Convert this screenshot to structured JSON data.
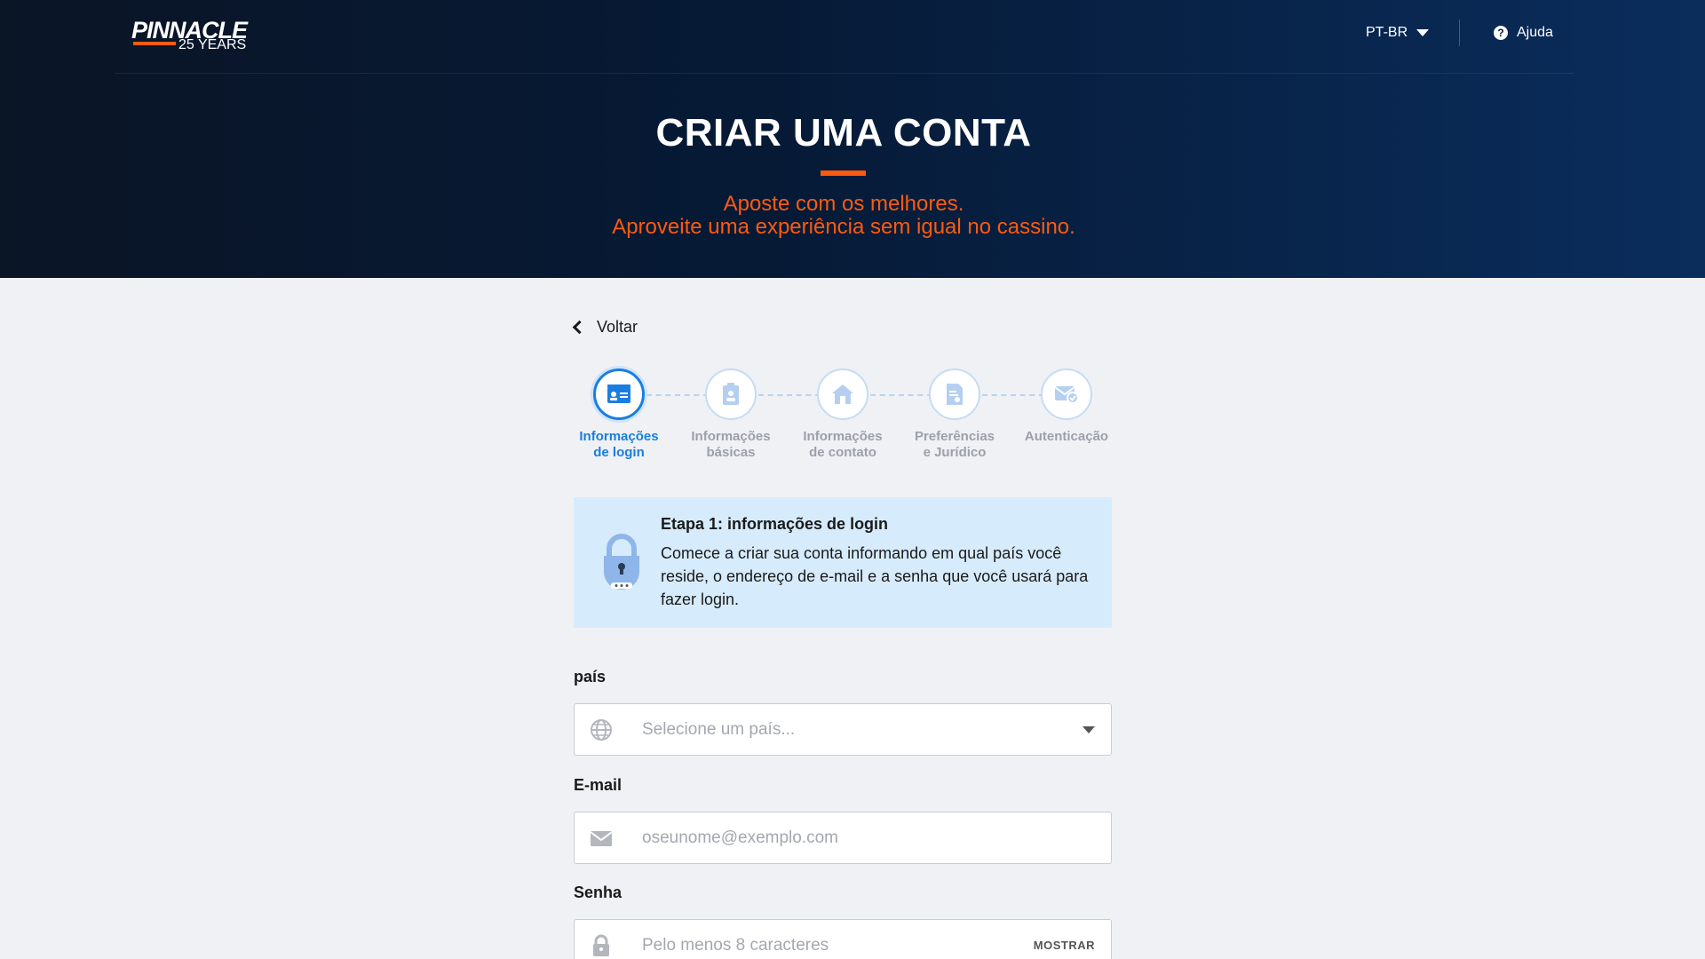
{
  "brand": {
    "name": "PINNACLE",
    "tagline": "25 YEARS",
    "accent": "#ff5a10",
    "primary_blue": "#1a7ee0"
  },
  "topbar": {
    "language": "PT-BR",
    "help_label": "Ajuda"
  },
  "hero": {
    "title": "CRIAR UMA CONTA",
    "subtitle_line1": "Aposte com os melhores.",
    "subtitle_line2": "Aproveite uma experiência sem igual no cassino."
  },
  "back_label": "Voltar",
  "steps": [
    {
      "line1": "Informações",
      "line2": "de login",
      "icon": "id-card-icon",
      "active": true
    },
    {
      "line1": "Informações",
      "line2": "básicas",
      "icon": "badge-icon",
      "active": false
    },
    {
      "line1": "Informações",
      "line2": "de contato",
      "icon": "home-icon",
      "active": false
    },
    {
      "line1": "Preferências",
      "line2": "e Jurídico",
      "icon": "document-icon",
      "active": false
    },
    {
      "line1": "Autenticação",
      "line2": "",
      "icon": "mail-check-icon",
      "active": false
    }
  ],
  "info": {
    "title": "Etapa 1: informações de login",
    "text": "Comece a criar sua conta informando em qual país você reside, o endereço de e-mail e a senha que você usará para fazer login."
  },
  "form": {
    "country": {
      "label": "país",
      "placeholder": "Selecione um país...",
      "icon": "globe-icon"
    },
    "email": {
      "label": "E-mail",
      "placeholder": "oseunome@exemplo.com",
      "icon": "envelope-icon"
    },
    "password": {
      "label": "Senha",
      "placeholder": "Pelo menos 8 caracteres",
      "icon": "lock-icon",
      "show_label": "MOSTRAR"
    }
  }
}
